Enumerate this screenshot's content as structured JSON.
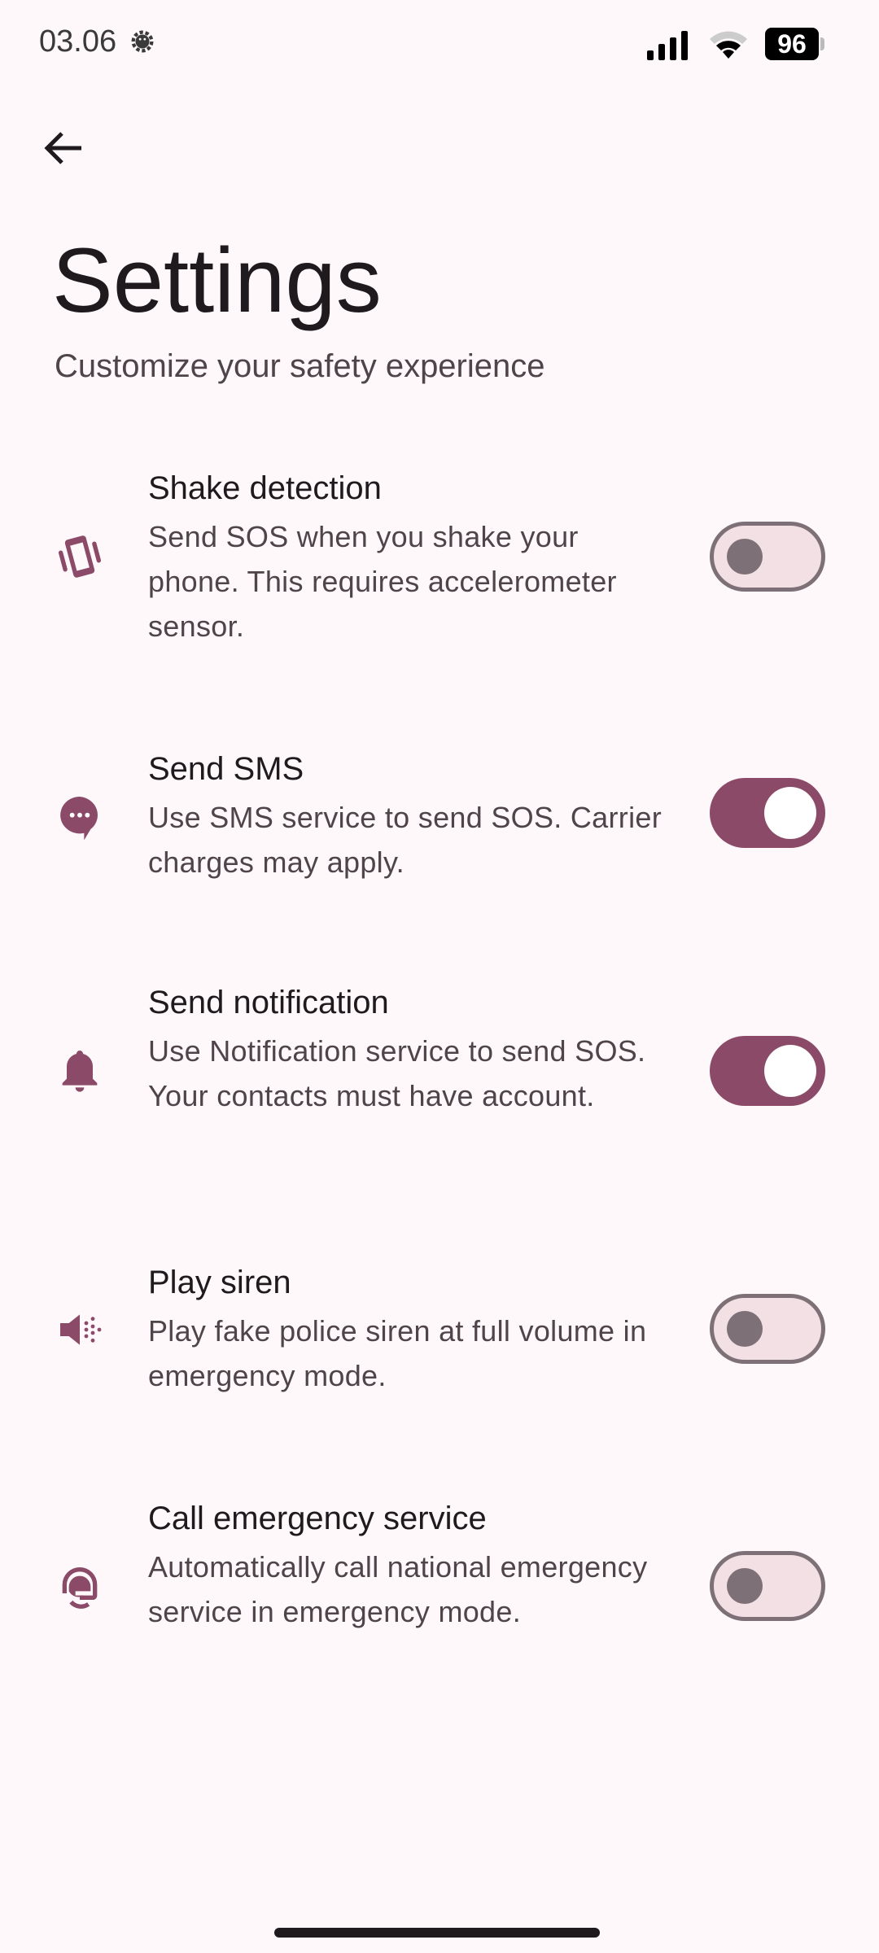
{
  "status_bar": {
    "time": "03.06",
    "battery": "96"
  },
  "header": {
    "title": "Settings",
    "subtitle": "Customize your safety experience"
  },
  "colors": {
    "accent": "#8a4a68",
    "background": "#fef8fb",
    "toggle_off_track": "#f2e0e4",
    "toggle_off_outline": "#7d7076"
  },
  "settings": [
    {
      "icon": "vibrate-phone-icon",
      "title": "Shake detection",
      "description": "Send SOS when you shake your phone. This requires accelerometer sensor.",
      "enabled": false
    },
    {
      "icon": "chat-bubble-icon",
      "title": "Send SMS",
      "description": "Use SMS service to send SOS. Carrier charges may apply.",
      "enabled": true
    },
    {
      "icon": "bell-icon",
      "title": "Send notification",
      "description": "Use Notification service to send SOS. Your contacts must have account.",
      "enabled": true
    },
    {
      "icon": "siren-speaker-icon",
      "title": "Play siren",
      "description": "Play fake police siren at full volume in emergency mode.",
      "enabled": false
    },
    {
      "icon": "support-agent-icon",
      "title": "Call emergency service",
      "description": "Automatically call national emergency service in emergency mode.",
      "enabled": false
    }
  ]
}
